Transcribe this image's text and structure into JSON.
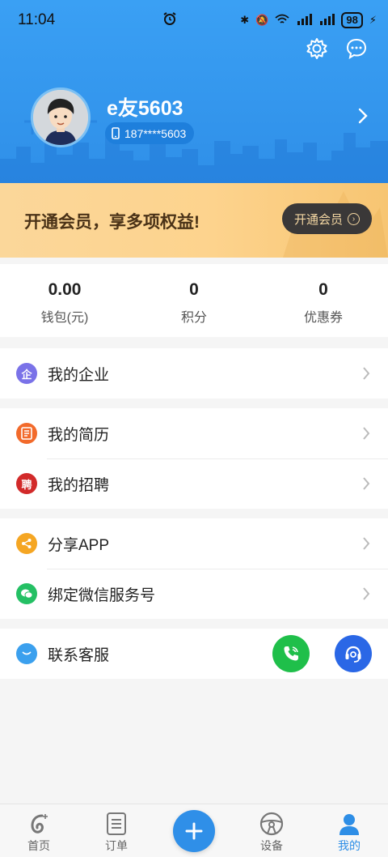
{
  "status_bar": {
    "time": "11:04",
    "battery": "98"
  },
  "profile": {
    "username": "e友5603",
    "phone": "187****5603"
  },
  "vip": {
    "title": "开通会员，享多项权益!",
    "button_label": "开通会员"
  },
  "stats": [
    {
      "value": "0.00",
      "label": "钱包(元)"
    },
    {
      "value": "0",
      "label": "积分"
    },
    {
      "value": "0",
      "label": "优惠券"
    }
  ],
  "menu": {
    "enterprise": {
      "label": "我的企业",
      "icon_char": "企"
    },
    "resume": {
      "label": "我的简历"
    },
    "recruit": {
      "label": "我的招聘",
      "icon_char": "聘"
    },
    "share": {
      "label": "分享APP"
    },
    "wechat": {
      "label": "绑定微信服务号"
    },
    "service": {
      "label": "联系客服"
    }
  },
  "nav": {
    "home": "首页",
    "orders": "订单",
    "devices": "设备",
    "mine": "我的"
  },
  "colors": {
    "header_blue": "#3aa0f4",
    "vip_gold": "#fbd79a",
    "accent_blue": "#2f8fe8",
    "enterprise_purple": "#7a72e8",
    "resume_orange": "#f26a2b",
    "recruit_red": "#d22a2a",
    "share_orange": "#f5a623",
    "wechat_green": "#24c064",
    "phone_green": "#1fbf4a",
    "support_blue": "#2a67e6"
  }
}
